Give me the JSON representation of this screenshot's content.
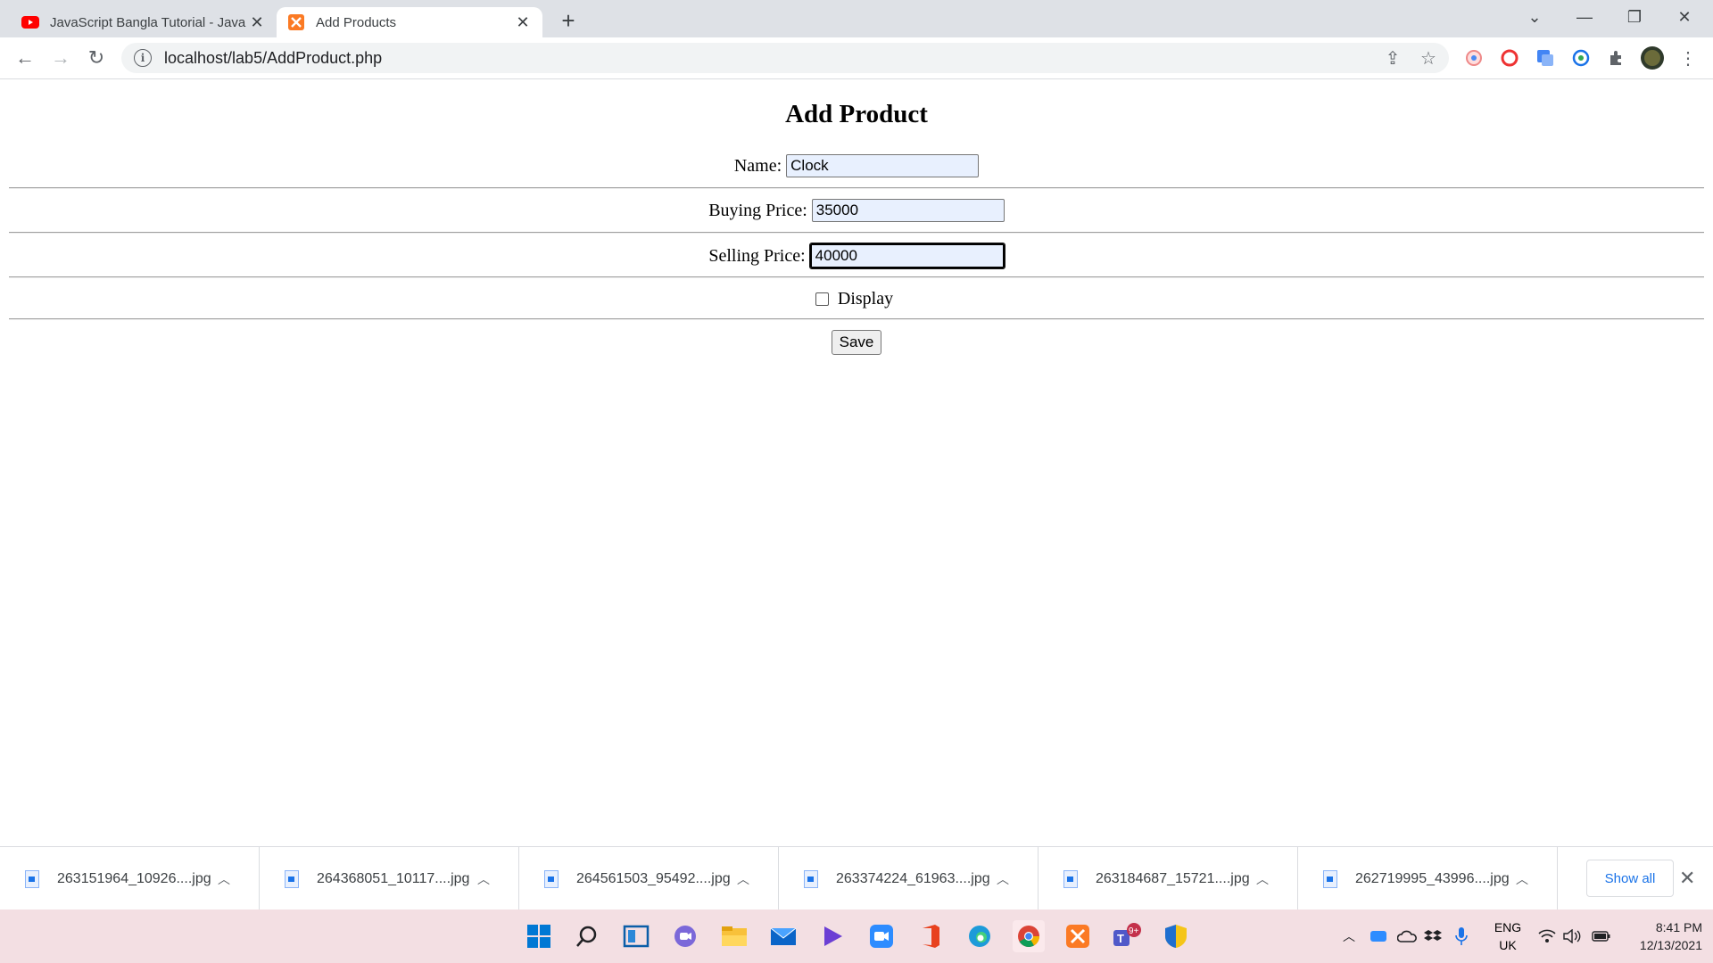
{
  "browser": {
    "tabs": [
      {
        "title": "JavaScript Bangla Tutorial - JavaS",
        "active": false
      },
      {
        "title": "Add Products",
        "active": true
      }
    ],
    "url": "localhost/lab5/AddProduct.php"
  },
  "form": {
    "heading": "Add Product",
    "name_label": "Name:",
    "name_value": "Clock",
    "buying_label": "Buying Price:",
    "buying_value": "35000",
    "selling_label": "Selling Price:",
    "selling_value": "40000",
    "display_label": "Display",
    "display_checked": false,
    "save_label": "Save"
  },
  "downloads": {
    "items": [
      "263151964_10926....jpg",
      "264368051_10117....jpg",
      "264561503_95492....jpg",
      "263374224_61963....jpg",
      "263184687_15721....jpg",
      "262719995_43996....jpg"
    ],
    "show_all": "Show all"
  },
  "taskbar": {
    "lang_line1": "ENG",
    "lang_line2": "UK",
    "time": "8:41 PM",
    "date": "12/13/2021",
    "teams_badge": "9+"
  },
  "colors": {
    "tabbar_bg": "#dee1e6",
    "taskbar_bg": "#f3dfe3",
    "link_blue": "#1a73e8",
    "youtube_red": "#ff0000",
    "xampp_orange": "#fb7a24"
  }
}
